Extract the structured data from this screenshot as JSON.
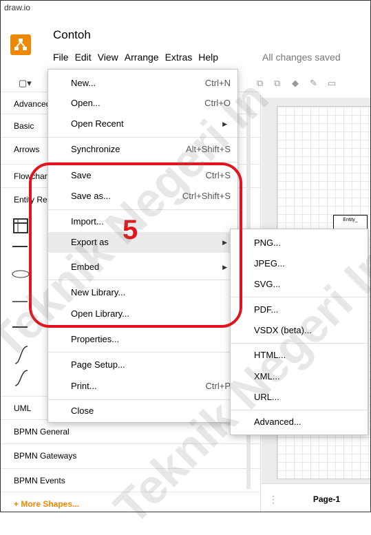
{
  "window": {
    "title": "draw.io"
  },
  "header": {
    "doc_title": "Contoh",
    "menus": [
      "File",
      "Edit",
      "View",
      "Arrange",
      "Extras",
      "Help"
    ],
    "status": "All changes saved"
  },
  "sidebar": {
    "categories": [
      "Advanced",
      "Basic",
      "Arrows",
      "Flowchart",
      "Entity Relation",
      "UML",
      "BPMN General",
      "BPMN Gateways",
      "BPMN Events"
    ],
    "more_shapes": "+ More Shapes..."
  },
  "canvas": {
    "entity_label": "Entity_",
    "page_tab": "Page-1"
  },
  "file_menu": {
    "items": [
      {
        "label": "New...",
        "shortcut": "Ctrl+N"
      },
      {
        "label": "Open...",
        "shortcut": "Ctrl+O"
      },
      {
        "label": "Open Recent",
        "shortcut": ""
      },
      {
        "label": "Synchronize",
        "shortcut": "Alt+Shift+S"
      },
      {
        "label": "Save",
        "shortcut": "Ctrl+S"
      },
      {
        "label": "Save as...",
        "shortcut": "Ctrl+Shift+S"
      },
      {
        "label": "Import...",
        "shortcut": ""
      },
      {
        "label": "Export as",
        "shortcut": ""
      },
      {
        "label": "Embed",
        "shortcut": ""
      },
      {
        "label": "New Library...",
        "shortcut": ""
      },
      {
        "label": "Open Library...",
        "shortcut": ""
      },
      {
        "label": "Properties...",
        "shortcut": ""
      },
      {
        "label": "Page Setup...",
        "shortcut": ""
      },
      {
        "label": "Print...",
        "shortcut": "Ctrl+P"
      },
      {
        "label": "Close",
        "shortcut": ""
      }
    ]
  },
  "export_submenu": {
    "items": [
      "PNG...",
      "JPEG...",
      "SVG...",
      "PDF...",
      "VSDX (beta)...",
      "HTML...",
      "XML...",
      "URL...",
      "Advanced..."
    ]
  },
  "annotation": {
    "step": "5",
    "color": "#e3131e"
  },
  "watermark": {
    "text": "Teknik Negeri In"
  },
  "colors": {
    "accent": "#f08705",
    "highlight": "#e3131e"
  }
}
